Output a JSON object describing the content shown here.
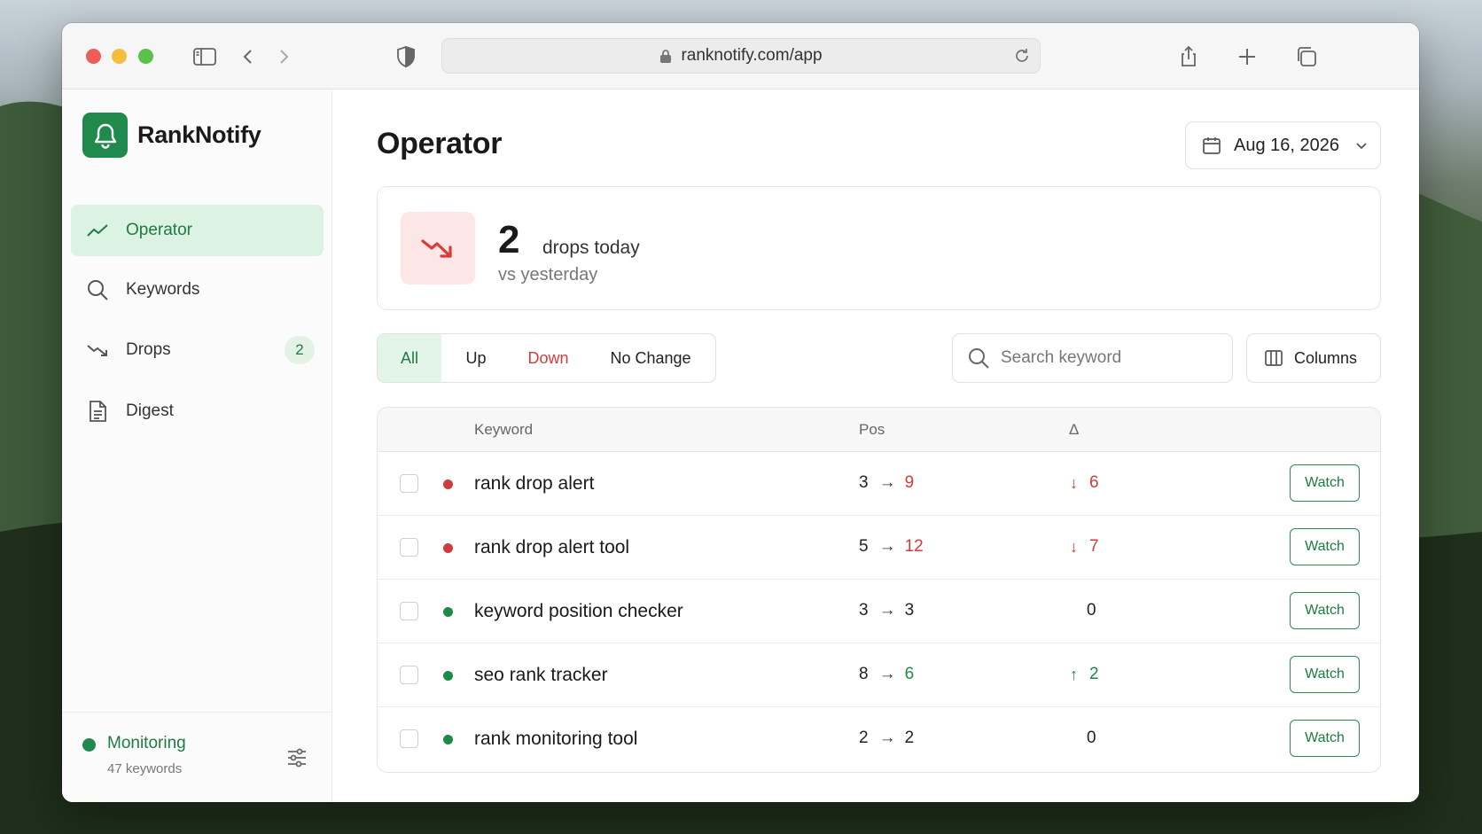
{
  "browser": {
    "url": "ranknotify.com/app"
  },
  "brand": {
    "name": "RankNotify"
  },
  "sidebar": {
    "items": [
      {
        "label": "Operator",
        "icon": "trend-line-icon",
        "active": true
      },
      {
        "label": "Keywords",
        "icon": "search-icon",
        "active": false
      },
      {
        "label": "Drops",
        "icon": "trend-down-icon",
        "active": false,
        "badge": "2"
      },
      {
        "label": "Digest",
        "icon": "document-icon",
        "active": false
      }
    ],
    "footer": {
      "status": "Monitoring",
      "sub": "47 keywords"
    }
  },
  "main": {
    "title": "Operator",
    "date": "Aug 16, 2026",
    "stat": {
      "value": "2",
      "label": "drops today",
      "sub": "vs yesterday"
    },
    "filters": [
      "All",
      "Up",
      "Down",
      "No Change"
    ],
    "active_filter": "All",
    "search_placeholder": "Search keyword",
    "columns_label": "Columns"
  },
  "table": {
    "headers": {
      "keyword": "Keyword",
      "pos": "Pos",
      "delta": "Δ"
    },
    "rows": [
      {
        "status": "down",
        "keyword": "rank drop alert",
        "from": "3",
        "to": "9",
        "arrow": "↓",
        "delta": "6",
        "action": "Watch"
      },
      {
        "status": "down",
        "keyword": "rank drop alert tool",
        "from": "5",
        "to": "12",
        "arrow": "↓",
        "delta": "7",
        "action": "Watch"
      },
      {
        "status": "stable",
        "keyword": "keyword position checker",
        "from": "3",
        "to": "3",
        "arrow": "",
        "delta": "0",
        "action": "Watch"
      },
      {
        "status": "up",
        "keyword": "seo rank tracker",
        "from": "8",
        "to": "6",
        "arrow": "↑",
        "delta": "2",
        "action": "Watch"
      },
      {
        "status": "stable",
        "keyword": "rank monitoring tool",
        "from": "2",
        "to": "2",
        "arrow": "",
        "delta": "0",
        "action": "Watch"
      }
    ]
  },
  "colors": {
    "brand_green": "#1f8a4c",
    "down_red": "#d23b3b",
    "up_green": "#1e8a47"
  }
}
